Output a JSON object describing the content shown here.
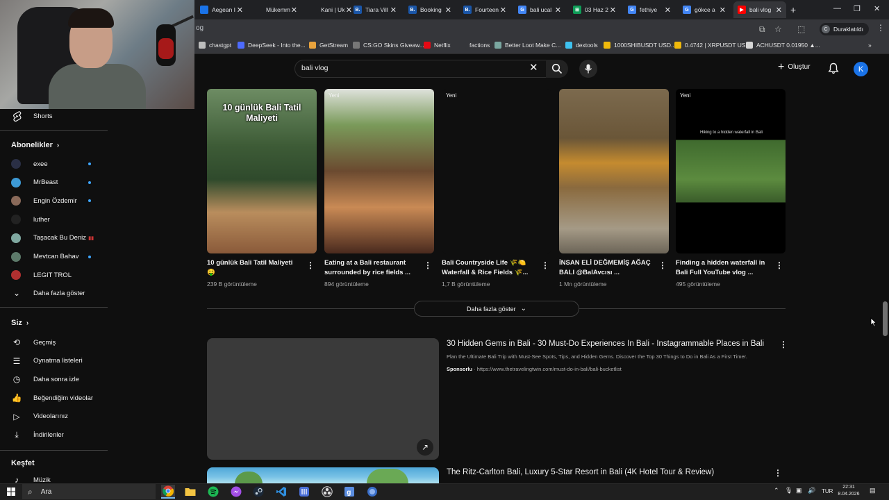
{
  "browser": {
    "tabs": [
      {
        "label": "Aegean I",
        "icon_color": "#1a73e8",
        "icon_text": ""
      },
      {
        "label": "Mükemm",
        "icon_color": "#202124",
        "icon_text": ""
      },
      {
        "label": "Kani | Uk",
        "icon_color": "#202124",
        "icon_text": ""
      },
      {
        "label": "Tiara Vill",
        "icon_color": "#1a56a8",
        "icon_text": "B."
      },
      {
        "label": "Booking",
        "icon_color": "#1a56a8",
        "icon_text": "B."
      },
      {
        "label": "Fourteen",
        "icon_color": "#1a56a8",
        "icon_text": "B."
      },
      {
        "label": "bali ucal",
        "icon_color": "#4285f4",
        "icon_text": "G"
      },
      {
        "label": "03 Haz 2",
        "icon_color": "#0f9d58",
        "icon_text": "⊞"
      },
      {
        "label": "fethiye",
        "icon_color": "#4285f4",
        "icon_text": "G"
      },
      {
        "label": "gökce a",
        "icon_color": "#4285f4",
        "icon_text": "G"
      },
      {
        "label": "bali vlog",
        "icon_color": "#ff0000",
        "icon_text": "▶"
      }
    ],
    "url": "og",
    "profile_label": "Duraklatıldı",
    "bookmarks": [
      {
        "label": "chastgpt",
        "color": "#bdbdbd"
      },
      {
        "label": "DeepSeek - Into the...",
        "color": "#4d6bfe"
      },
      {
        "label": "GetStream",
        "color": "#e8a33d"
      },
      {
        "label": "CS:GO Skins Giveaw...",
        "color": "#777777"
      },
      {
        "label": "Netflix",
        "color": "#e50914"
      },
      {
        "label": "factions",
        "color": "#35363a"
      },
      {
        "label": "Better Loot Make C...",
        "color": "#7aa7a0"
      },
      {
        "label": "dextools",
        "color": "#3ec2f0"
      },
      {
        "label": "1000SHIBUSDT USD...",
        "color": "#f0b90b"
      },
      {
        "label": "0.4742 | XRPUSDT US...",
        "color": "#f0b90b"
      },
      {
        "label": "ACHUSDT 0.01950 ▲...",
        "color": "#d6d6d6"
      }
    ]
  },
  "search": {
    "query": "bali vlog",
    "create_label": "Oluştur",
    "avatar_letter": "K"
  },
  "sidebar": {
    "shorts_label": "Shorts",
    "subscriptions_heading": "Abonelikler",
    "subscriptions": [
      {
        "name": "exee",
        "color": "#2a2f45",
        "dot": true,
        "live": false
      },
      {
        "name": "MrBeast",
        "color": "#3d9ad6",
        "dot": true,
        "live": false
      },
      {
        "name": "Engin Özdemir",
        "color": "#8a6a5a",
        "dot": true,
        "live": false
      },
      {
        "name": "luther",
        "color": "#222222",
        "dot": false,
        "live": false
      },
      {
        "name": "Taşacak Bu Deniz",
        "color": "#7fa8a0",
        "dot": false,
        "live": true
      },
      {
        "name": "Mevtcan Bahav",
        "color": "#5d7a6a",
        "dot": true,
        "live": false
      },
      {
        "name": "LEGIT TROL",
        "color": "#b03030",
        "dot": false,
        "live": false
      }
    ],
    "show_more_label": "Daha fazla göster",
    "you_heading": "Siz",
    "you_items": [
      {
        "label": "Geçmiş",
        "icon": "history-icon"
      },
      {
        "label": "Oynatma listeleri",
        "icon": "playlists-icon"
      },
      {
        "label": "Daha sonra izle",
        "icon": "watch-later-icon"
      },
      {
        "label": "Beğendiğim videolar",
        "icon": "like-icon"
      },
      {
        "label": "Videolarınız",
        "icon": "your-videos-icon"
      },
      {
        "label": "İndirilenler",
        "icon": "download-icon"
      }
    ],
    "explore_heading": "Keşfet",
    "explore_items": [
      {
        "label": "Müzik",
        "icon": "music-icon"
      }
    ]
  },
  "shorts": [
    {
      "title": "10 günlük Bali Tatil Maliyeti 🤑",
      "views": "239 B görüntüleme",
      "overlay": "10 günlük Bali Tatil Maliyeti",
      "new": false
    },
    {
      "title": "Eating at a Bali restaurant surrounded by rice fields ...",
      "views": "894 görüntüleme",
      "overlay": "",
      "new": true,
      "new_label": "Yeni"
    },
    {
      "title": "Bali Countryside Life 🌾🍋 Waterfall & Rice Fields 🌾...",
      "views": "1,7 B görüntüleme",
      "overlay": "",
      "new": true,
      "new_label": "Yeni"
    },
    {
      "title": "İNSAN ELİ DEĞMEMİŞ AĞAÇ BALI @BalAvcısı ...",
      "views": "1 Mn görüntüleme",
      "overlay": "",
      "new": false
    },
    {
      "title": "Finding a hidden waterfall in Bali Full YouTube vlog ...",
      "views": "495 görüntüleme",
      "overlay": "Hiking to a hidden waterfall in Bali",
      "new": true,
      "new_label": "Yeni"
    }
  ],
  "shorts_show_more": "Daha fazla göster",
  "results": [
    {
      "title": "30 Hidden Gems in Bali - 30 Must-Do Experiences In Bali - Instagrammable Places in Bali",
      "description": "Plan the Ultimate Bali Trip with Must-See Spots, Tips, and Hidden Gems. Discover the Top 30 Things to Do in Bali As a First Timer.",
      "sponsor_label": "Sponsorlu",
      "sponsor_url": "https://www.thetravelingtwin.com/must-do-in-bali/bali-bucketlist"
    },
    {
      "title": "The Ritz-Carlton Bali, Luxury 5-Star Resort in Bali (4K Hotel Tour & Review)"
    }
  ],
  "taskbar": {
    "search_label": "Ara",
    "language": "TUR",
    "time": "22:31",
    "date": "8.04.2026"
  }
}
